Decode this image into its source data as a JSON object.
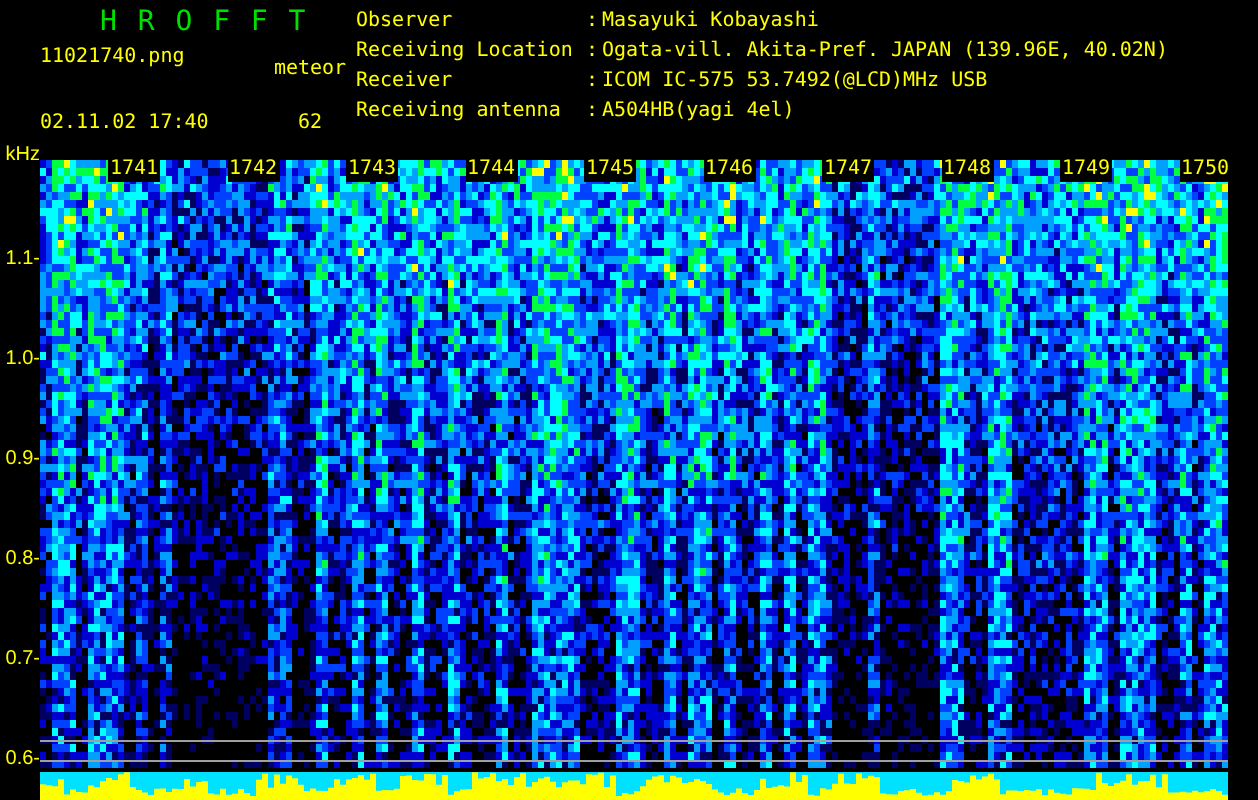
{
  "title": "H R O F F T",
  "file_name": "11021740.png",
  "timestamp": "02.11.02 17:40",
  "meteor": {
    "label": "meteor",
    "count": "62"
  },
  "station_info": [
    {
      "label": "Observer",
      "value": "Masayuki Kobayashi"
    },
    {
      "label": "Receiving Location",
      "value": "Ogata-vill. Akita-Pref. JAPAN (139.96E, 40.02N)"
    },
    {
      "label": "Receiver",
      "value": "ICOM IC-575 53.7492(@LCD)MHz USB"
    },
    {
      "label": "Receiving antenna",
      "value": "A504HB(yagi 4el)"
    }
  ],
  "separator": ":",
  "frequency_axis": {
    "unit": "kHz",
    "labels": [
      "1.1-",
      "1.0-",
      "0.9-",
      "0.8-",
      "0.7-",
      "0.6-"
    ]
  },
  "time_labels": [
    "1741",
    "1742",
    "1743",
    "1744",
    "1745",
    "1746",
    "1747",
    "1748",
    "1749",
    "1750"
  ]
}
